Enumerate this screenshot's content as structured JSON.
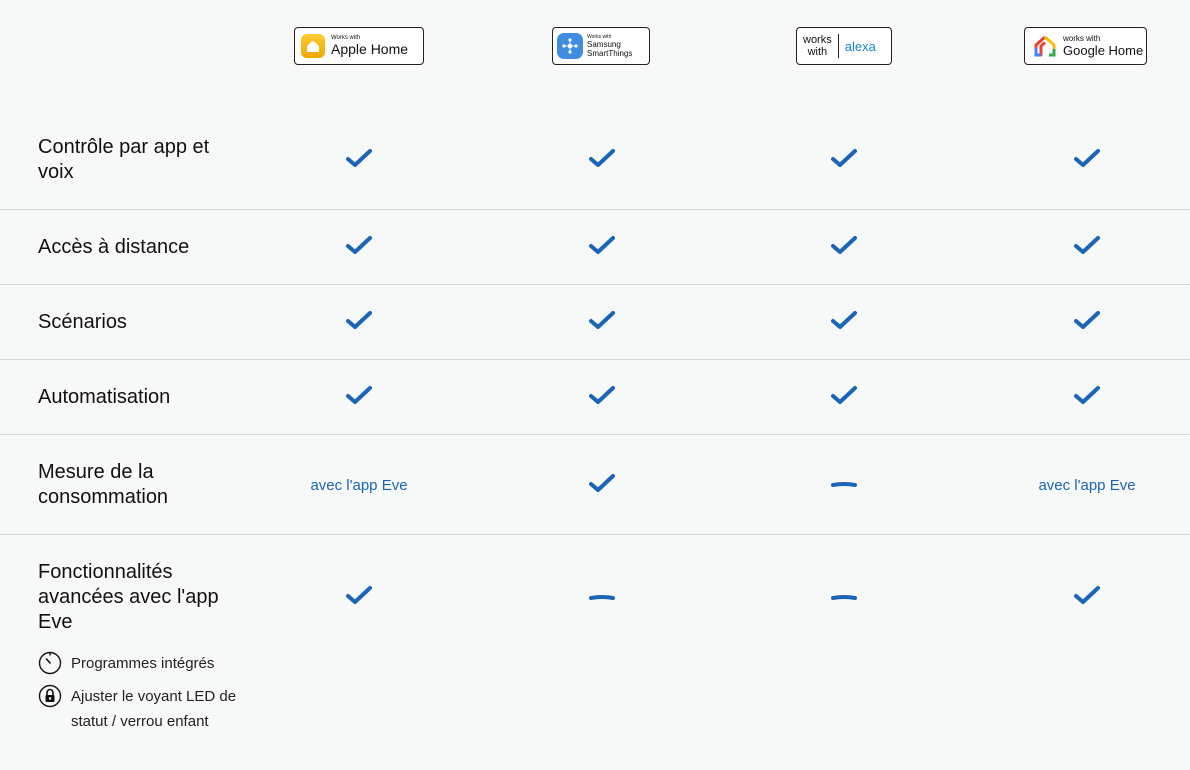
{
  "badges": {
    "apple": {
      "small": "Works with",
      "big": "Apple Home"
    },
    "smartthings": {
      "small": "Works with",
      "big1": "Samsung",
      "big2": "SmartThings"
    },
    "alexa": {
      "works1": "works",
      "works2": "with",
      "name": "alexa"
    },
    "google": {
      "small": "works with",
      "big": "Google Home"
    }
  },
  "rows": [
    {
      "label": "Contrôle par app et voix",
      "values": [
        "check",
        "check",
        "check",
        "check"
      ]
    },
    {
      "label": "Accès à distance",
      "values": [
        "check",
        "check",
        "check",
        "check"
      ]
    },
    {
      "label": "Scénarios",
      "values": [
        "check",
        "check",
        "check",
        "check"
      ]
    },
    {
      "label": "Automatisation",
      "values": [
        "check",
        "check",
        "check",
        "check"
      ]
    },
    {
      "label": "Mesure de la consommation",
      "values": [
        "avec l'app Eve",
        "check",
        "dash",
        "avec l'app Eve"
      ]
    },
    {
      "label": "Fonctionnalités avancées avec l'app Eve",
      "values": [
        "check",
        "dash",
        "dash",
        "check"
      ]
    }
  ],
  "advanced_features": [
    {
      "icon": "timer-icon",
      "text": "Programmes intégrés"
    },
    {
      "icon": "lock-icon",
      "text": "Ajuster le voyant LED de statut / verrou enfant"
    }
  ],
  "colors": {
    "accent": "#1a65b6",
    "background": "#f7f8f8",
    "separator": "#d6d8d8"
  }
}
